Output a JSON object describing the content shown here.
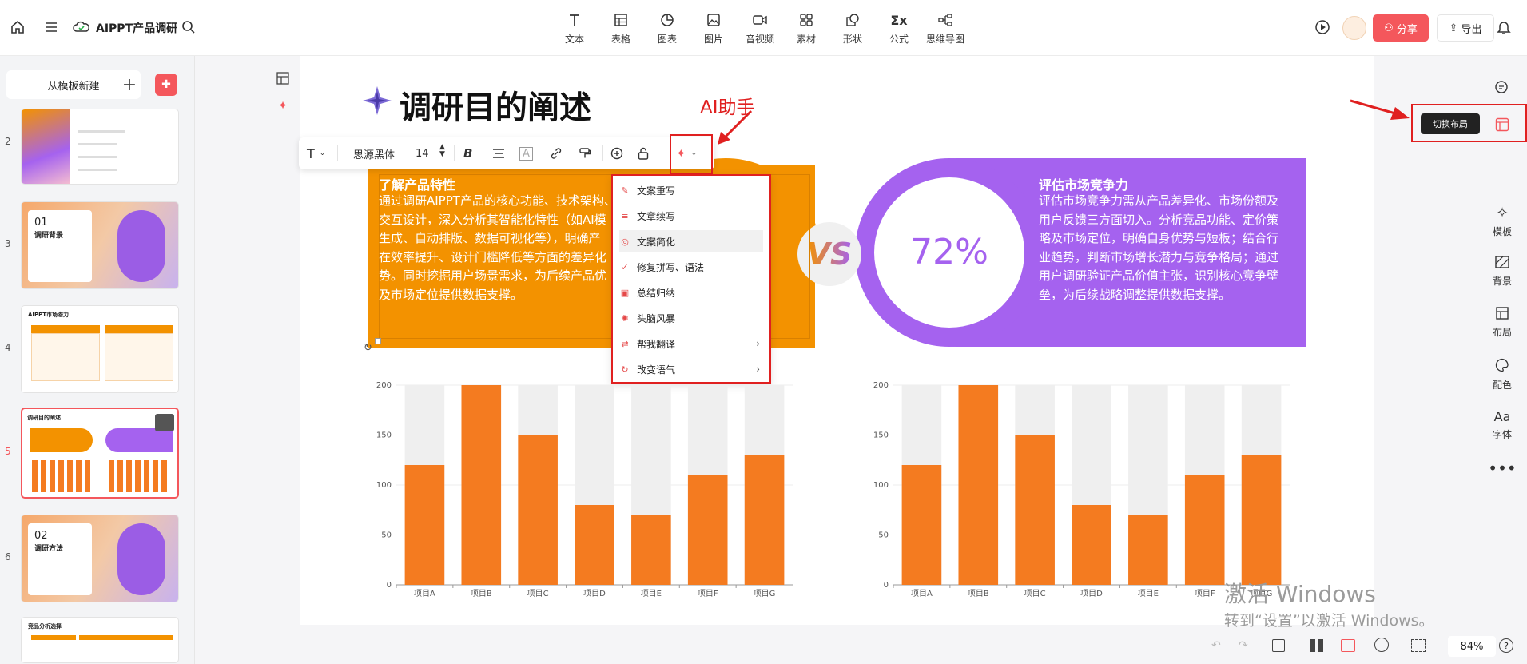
{
  "app": {
    "doc_title": "AIPPT产品调研"
  },
  "toolbar": {
    "items": [
      {
        "label": "文本",
        "icon": "text-icon"
      },
      {
        "label": "表格",
        "icon": "table-icon"
      },
      {
        "label": "图表",
        "icon": "chart-icon"
      },
      {
        "label": "图片",
        "icon": "image-icon"
      },
      {
        "label": "音视频",
        "icon": "video-icon"
      },
      {
        "label": "素材",
        "icon": "assets-icon"
      },
      {
        "label": "形状",
        "icon": "shape-icon"
      },
      {
        "label": "公式",
        "icon": "formula-icon"
      },
      {
        "label": "思维导图",
        "icon": "mindmap-icon"
      }
    ],
    "share_label": "分享",
    "export_label": "导出"
  },
  "left_panel": {
    "new_from_template": "从模板新建",
    "slides": [
      {
        "num": "2",
        "heading": "",
        "selected": false
      },
      {
        "num": "3",
        "heading": "01\n调研背景",
        "selected": false
      },
      {
        "num": "4",
        "heading": "AIPPT市场潜力",
        "selected": false
      },
      {
        "num": "5",
        "heading": "调研目的阐述",
        "selected": true
      },
      {
        "num": "6",
        "heading": "02\n调研方法",
        "selected": false
      },
      {
        "num": "",
        "heading": "竞品分析选择",
        "selected": false
      }
    ],
    "slide3_title": "01",
    "slide3_sub": "调研背景",
    "slide6_title": "02",
    "slide6_sub": "调研方法"
  },
  "slide": {
    "title": "调研目的阐述",
    "left_card": {
      "title": "了解产品特性",
      "lines": [
        "通过调研AIPPT产品的核心功能、技术架构、",
        "交互设计，深入分析其智能化特性（如AI模",
        "生成、自动排版、数据可视化等），明确产",
        "在效率提升、设计门槛降低等方面的差异化",
        "势。同时挖掘用户场景需求，为后续产品优",
        "及市场定位提供数据支撑。"
      ]
    },
    "vs": "VS",
    "percent": "72%",
    "right_card": {
      "title": "评估市场竞争力",
      "lines": [
        "评估市场竞争力需从产品差异化、市场份额及",
        "用户反馈三方面切入。分析竞品功能、定价策",
        "略及市场定位，明确自身优势与短板；结合行",
        "业趋势，判断市场增长潜力与竞争格局；通过",
        "用户调研验证产品价值主张，识别核心竞争壁",
        "垒，为后续战略调整提供数据支撑。"
      ]
    }
  },
  "text_toolbar": {
    "font": "思源黑体",
    "size": "14"
  },
  "ai_menu": {
    "annotation": "AI助手",
    "items": [
      {
        "label": "文案重写",
        "submenu": false
      },
      {
        "label": "文章续写",
        "submenu": false
      },
      {
        "label": "文案简化",
        "submenu": false
      },
      {
        "label": "修复拼写、语法",
        "submenu": false
      },
      {
        "label": "总结归纳",
        "submenu": false
      },
      {
        "label": "头脑风暴",
        "submenu": false
      },
      {
        "label": "帮我翻译",
        "submenu": true
      },
      {
        "label": "改变语气",
        "submenu": true
      }
    ]
  },
  "chart_data": [
    {
      "type": "bar",
      "categories": [
        "项目A",
        "项目B",
        "项目C",
        "项目D",
        "项目E",
        "项目F",
        "项目G"
      ],
      "values": [
        120,
        200,
        150,
        80,
        70,
        110,
        130
      ],
      "background_max": 200,
      "ylim": [
        0,
        200
      ],
      "yticks": [
        0,
        50,
        100,
        150,
        200
      ],
      "color": "#f47b20",
      "bg_color": "#efefef"
    },
    {
      "type": "bar",
      "categories": [
        "项目A",
        "项目B",
        "项目C",
        "项目D",
        "项目E",
        "项目F",
        "项目G"
      ],
      "values": [
        120,
        200,
        150,
        80,
        70,
        110,
        130
      ],
      "background_max": 200,
      "ylim": [
        0,
        200
      ],
      "yticks": [
        0,
        50,
        100,
        150,
        200
      ],
      "color": "#f47b20",
      "bg_color": "#efefef"
    }
  ],
  "right_panel": {
    "tooltip": "切换布局",
    "items": [
      {
        "label": "模板",
        "icon": "template-icon"
      },
      {
        "label": "背景",
        "icon": "background-icon"
      },
      {
        "label": "布局",
        "icon": "layout-icon"
      },
      {
        "label": "配色",
        "icon": "palette-icon"
      },
      {
        "label": "字体",
        "icon": "font-icon"
      }
    ]
  },
  "bottom_bar": {
    "zoom": "84%"
  },
  "watermark": {
    "line1": "激活 Windows",
    "line2": "转到“设置”以激活 Windows。"
  },
  "colors": {
    "accent": "#f4575c",
    "orange": "#f39200",
    "purple": "#a562ef",
    "bar": "#f47b20"
  }
}
